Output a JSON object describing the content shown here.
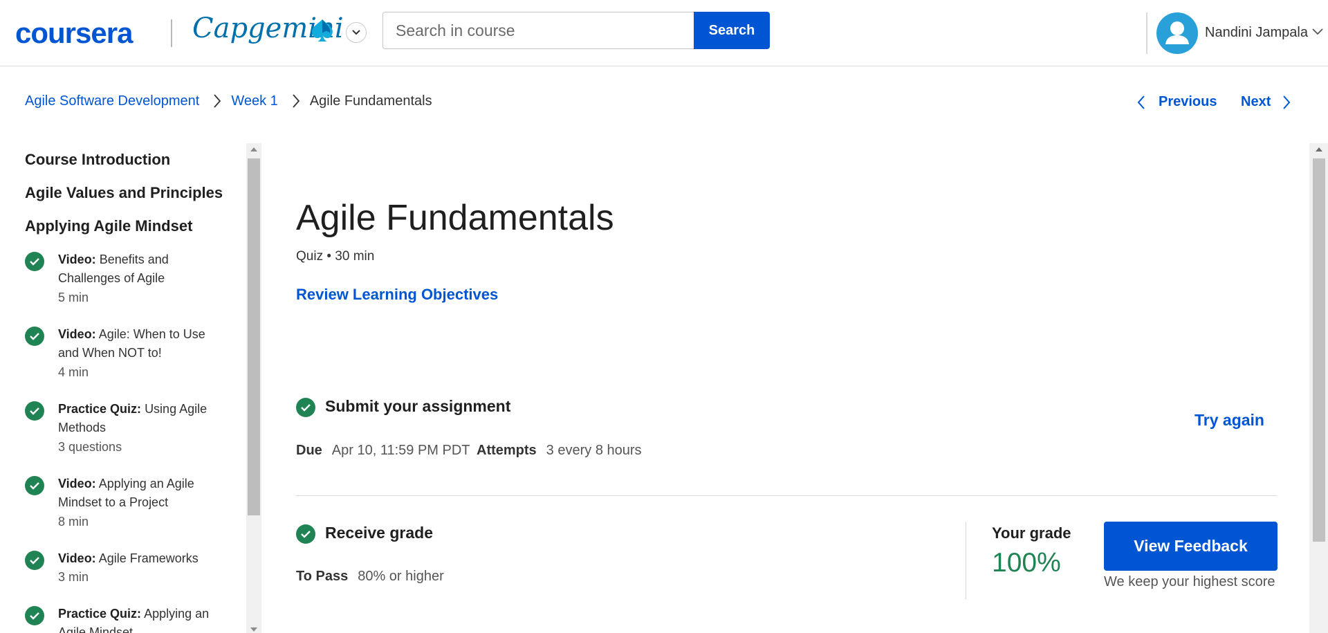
{
  "header": {
    "logo_text": "coursera",
    "partner_logo_text": "Capgemini",
    "search": {
      "placeholder": "Search in course",
      "value": "",
      "button_label": "Search"
    },
    "user": {
      "name": "Nandini Jampala"
    }
  },
  "breadcrumb": {
    "items": [
      "Agile Software Development",
      "Week 1"
    ],
    "current": "Agile Fundamentals"
  },
  "navigation": {
    "previous_label": "Previous",
    "next_label": "Next"
  },
  "sidebar": {
    "sections": [
      "Course Introduction",
      "Agile Values and Principles",
      "Applying Agile Mindset"
    ],
    "items": [
      {
        "type": "Video:",
        "title": "Benefits and Challenges of Agile",
        "meta": "5 min"
      },
      {
        "type": "Video:",
        "title": "Agile: When to Use and When NOT to!",
        "meta": "4 min"
      },
      {
        "type": "Practice Quiz:",
        "title": "Using Agile Methods",
        "meta": "3 questions"
      },
      {
        "type": "Video:",
        "title": "Applying an Agile Mindset to a Project",
        "meta": "8 min"
      },
      {
        "type": "Video:",
        "title": "Agile Frameworks",
        "meta": "3 min"
      },
      {
        "type": "Practice Quiz:",
        "title": "Applying an Agile Mindset",
        "meta": ""
      }
    ]
  },
  "main": {
    "title": "Agile Fundamentals",
    "meta": "Quiz • 30 min",
    "review_link": "Review Learning Objectives",
    "submit": {
      "title": "Submit your assignment",
      "due_label": "Due",
      "due_value": "Apr 10, 11:59 PM PDT",
      "attempts_label": "Attempts",
      "attempts_value": "3 every 8 hours",
      "try_again_label": "Try again"
    },
    "grade": {
      "title": "Receive grade",
      "to_pass_label": "To Pass",
      "to_pass_value": "80% or higher",
      "your_grade_label": "Your grade",
      "your_grade_value": "100%",
      "view_feedback_label": "View Feedback",
      "note": "We keep your highest score"
    }
  },
  "colors": {
    "primary": "#0056d2",
    "success": "#1f8354",
    "avatar": "#29a0d8",
    "partner": "#0070ad"
  },
  "icons": [
    "chevron-down-icon",
    "chevron-right-icon",
    "chevron-left-icon",
    "check-circle-icon",
    "user-avatar-icon",
    "spade-logo-icon"
  ]
}
